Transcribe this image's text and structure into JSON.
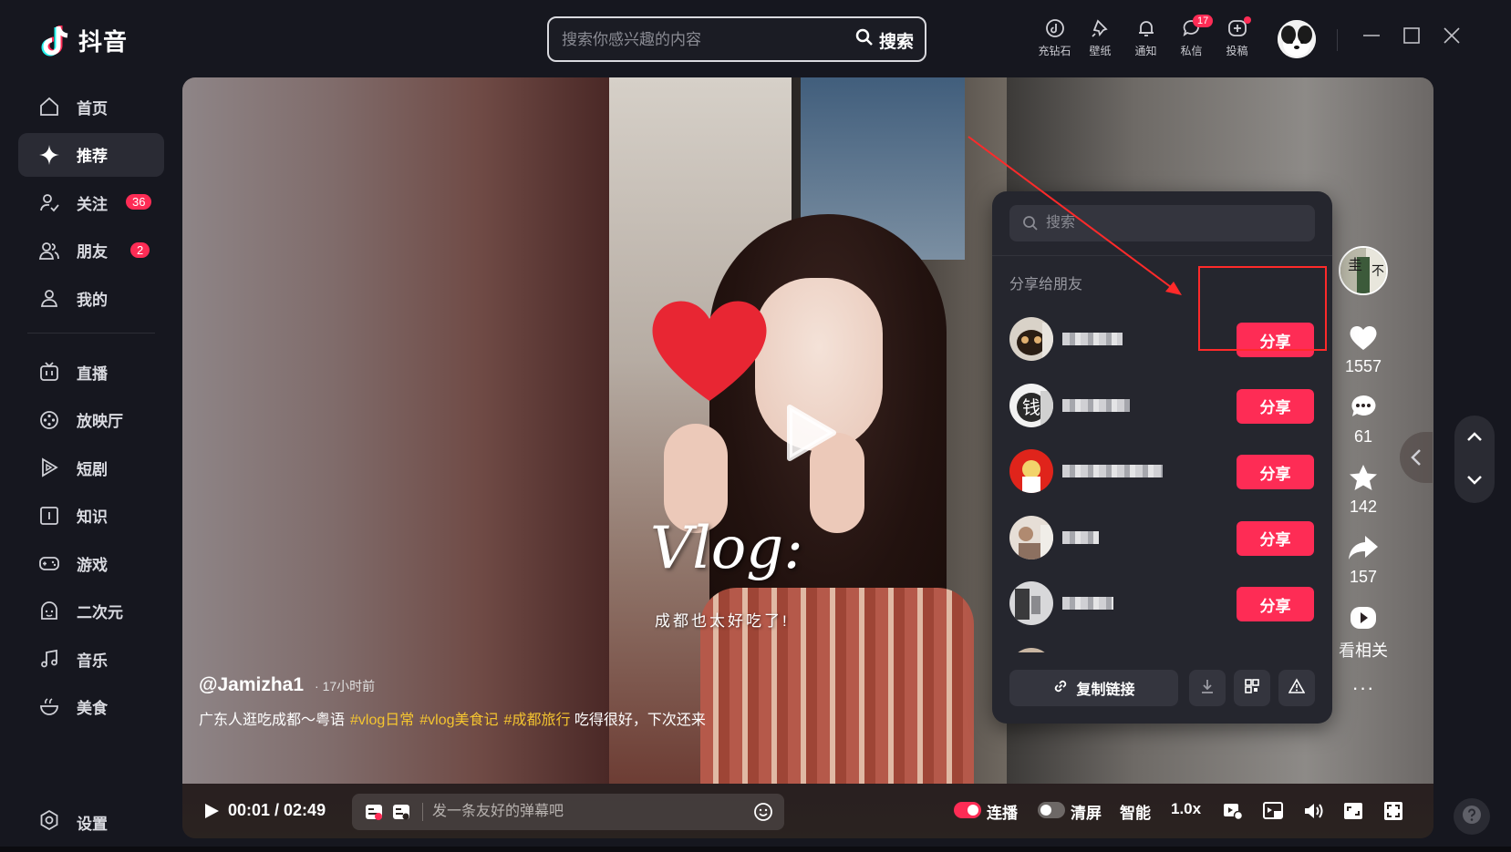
{
  "app": {
    "name": "抖音"
  },
  "search": {
    "placeholder": "搜索你感兴趣的内容",
    "button_label": "搜索"
  },
  "top_actions": [
    {
      "label": "充钻石",
      "icon": "diamond-icon"
    },
    {
      "label": "壁纸",
      "icon": "wallpaper-icon"
    },
    {
      "label": "通知",
      "icon": "bell-icon"
    },
    {
      "label": "私信",
      "icon": "message-icon",
      "badge": "17"
    },
    {
      "label": "投稿",
      "icon": "upload-icon"
    }
  ],
  "sidebar": {
    "items": [
      {
        "label": "首页",
        "icon": "home-icon"
      },
      {
        "label": "推荐",
        "icon": "sparkle-icon",
        "active": true
      },
      {
        "label": "关注",
        "icon": "follow-icon",
        "badge": "36"
      },
      {
        "label": "朋友",
        "icon": "friends-icon",
        "badge": "2"
      },
      {
        "label": "我的",
        "icon": "user-icon"
      }
    ],
    "items2": [
      {
        "label": "直播",
        "icon": "live-tv-icon"
      },
      {
        "label": "放映厅",
        "icon": "film-reel-icon"
      },
      {
        "label": "短剧",
        "icon": "short-drama-icon"
      },
      {
        "label": "知识",
        "icon": "knowledge-icon"
      },
      {
        "label": "游戏",
        "icon": "gamepad-icon"
      },
      {
        "label": "二次元",
        "icon": "anime-icon"
      },
      {
        "label": "音乐",
        "icon": "music-note-icon"
      },
      {
        "label": "美食",
        "icon": "food-bowl-icon"
      }
    ],
    "settings_label": "设置"
  },
  "video": {
    "overlay_title": "Vlog:",
    "overlay_subtitle": "成都也太好吃了!",
    "author": "@Jamizha1",
    "post_time": "· 17小时前",
    "description": "广东人逛吃成都～粤语",
    "hashtags": [
      "#vlog日常",
      "#vlog美食记",
      "#成都旅行"
    ],
    "description_tail": "吃得很好，下次还来"
  },
  "controls": {
    "time": "00:01 / 02:49",
    "danmu_placeholder": "发一条友好的弹幕吧",
    "autoplay_label": "连播",
    "autoplay_on": true,
    "clear_label": "清屏",
    "clear_on": false,
    "smart_label": "智能",
    "speed_label": "1.0x"
  },
  "actions": {
    "likes": "1557",
    "comments": "61",
    "favorites": "142",
    "shares": "157",
    "related_label": "看相关",
    "more_label": "···"
  },
  "share_popup": {
    "search_placeholder": "搜索",
    "section_title": "分享给朋友",
    "share_button_label": "分享",
    "friends_count": 6,
    "copy_link_label": "复制链接"
  },
  "colors": {
    "accent": "#fe2c55",
    "hashtag": "#f4c430",
    "annotation": "#ff2a2a"
  }
}
